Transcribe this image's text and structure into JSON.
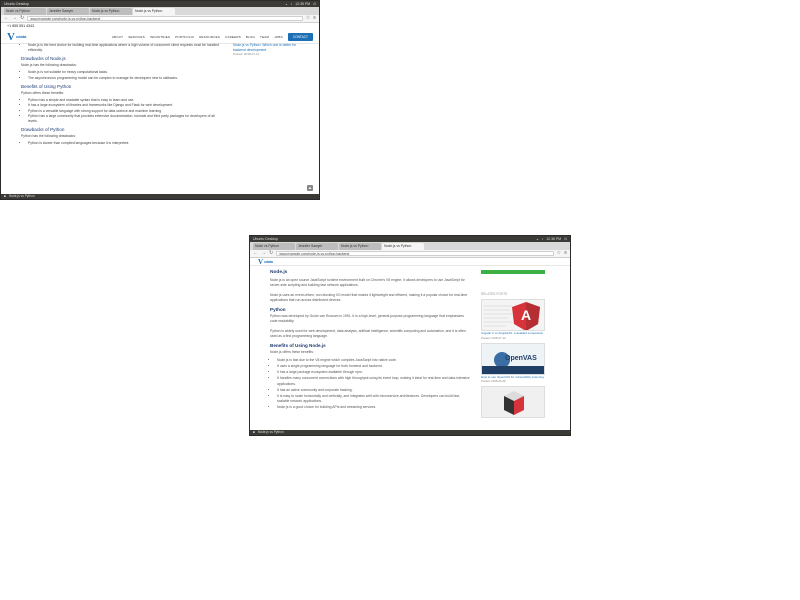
{
  "window1": {
    "topbar_left": "Ubuntu Desktop",
    "topbar_right": "12:35 PM",
    "tabs": [
      "Node vs Python",
      "Jennifer Sawyer",
      "Node.js vs Python",
      "Node.js vs Python"
    ],
    "url": "www.example.com/node-js-vs-python-backend",
    "site_topline": "+1 855 551 4343",
    "logo_text": "cdata",
    "menu": [
      "ABOUT",
      "SERVICES",
      "INDUSTRIES",
      "PORTFOLIO",
      "RESOURCES",
      "CAREERS",
      "BLOG",
      "TEAM",
      "JOBS"
    ],
    "contact": "CONTACT",
    "intro_bullet": "Node.js is the best choice for building real-time applications where a high volume of concurrent client requests must be handled efficiently.",
    "drawbacks_node_title": "Drawbacks of Node.js",
    "drawbacks_node_intro": "Node.js has the following drawbacks:",
    "drawbacks_node_items": [
      "Node.js is not suitable for heavy computational tasks.",
      "The asynchronous programming model can be complex to manage for developers new to callbacks."
    ],
    "benefits_python_title": "Benefits of Using Python",
    "benefits_python_intro": "Python offers these benefits:",
    "benefits_python_items": [
      "Python has a simple and readable syntax that is easy to learn and use.",
      "It has a large ecosystem of libraries and frameworks like Django and Flask for web development.",
      "Python is a versatile language with strong support for data science and machine learning.",
      "Python has a large community that provides extensive documentation, tutorials and third party packages for developers of all levels."
    ],
    "drawbacks_python_title": "Drawbacks of Python",
    "drawbacks_python_intro": "Python has the following drawbacks:",
    "drawbacks_python_items": [
      "Python is slower than compiled languages because it is interpreted."
    ],
    "sidebar_link": "Node.js vs Python: Which one is better for backend development",
    "sidebar_date": "Posted: 2018-07-12",
    "statusbar": "Node.js vs Python"
  },
  "window2": {
    "topbar_left": "Ubuntu Desktop",
    "topbar_right": "12:36 PM",
    "tabs": [
      "Node vs Python",
      "Jennifer Sawyer",
      "Node.js vs Python",
      "Node.js vs Python"
    ],
    "url": "www.example.com/node-js-vs-python-backend",
    "logo_text": "cdata",
    "nodejs_title": "Node.js",
    "nodejs_p1": "Node.js is an open source JavaScript runtime environment built on Chrome's V8 engine. It allows developers to use JavaScript for server-side scripting and building fast network applications.",
    "nodejs_p2": "Node.js uses an event-driven, non-blocking I/O model that makes it lightweight and efficient, making it a popular choice for real-time applications that run across distributed devices.",
    "python_title": "Python",
    "python_p1": "Python was developed by Guido van Rossum in 1991. It is a high-level, general-purpose programming language that emphasizes code readability.",
    "python_p2": "Python is widely used for web development, data analysis, artificial intelligence, scientific computing and automation, and it is often used as a first programming language.",
    "benefits_node_title": "Benefits of Using Node.js",
    "benefits_node_intro": "Node.js offers these benefits:",
    "benefits_node_items": [
      "Node.js is fast due to the V8 engine which compiles JavaScript into native code.",
      "It uses a single programming language for both frontend and backend.",
      "It has a large package ecosystem available through npm.",
      "It handles many concurrent connections with high throughput using its event loop, making it ideal for real-time and data-intensive applications.",
      "It has an active community and corporate backing.",
      "It is easy to scale horizontally and vertically, and integrates well with microservice architectures. Developers can build fast, scalable network applications.",
      "Node.js is a good choice for building APIs and streaming services."
    ],
    "sidebar_title": "RELATED POSTS",
    "thumbs": [
      {
        "caption": "Angular 2 vs AngularJS: a detailed comparison",
        "date": "Posted: 2018-07-12"
      },
      {
        "caption": "How to use OpenVAS for vulnerability scanning",
        "date": "Posted: 2018-06-28"
      },
      {
        "caption": "",
        "date": ""
      }
    ],
    "openvas_label": "OpenVAS",
    "angular_label": "A",
    "statusbar": "Node.js vs Python"
  },
  "colors": {
    "brand": "#1c6fb5",
    "heading": "#1e3c72",
    "green": "#3cb043",
    "angular_red": "#d6343a"
  }
}
